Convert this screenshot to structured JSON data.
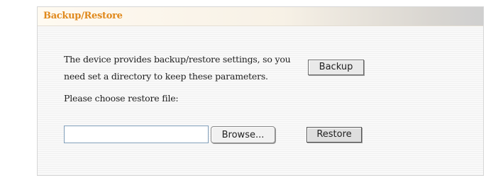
{
  "panel": {
    "title": "Backup/Restore"
  },
  "backup": {
    "description_line1": "The device provides backup/restore settings, so you",
    "description_line2": "need set a directory to keep these parameters.",
    "button_label": "Backup"
  },
  "restore": {
    "prompt": "Please choose restore file:",
    "file_value": "",
    "browse_label": "Browse...",
    "button_label": "Restore"
  },
  "colors": {
    "title": "#e0891c",
    "panel_background": "#f9f9f9"
  }
}
